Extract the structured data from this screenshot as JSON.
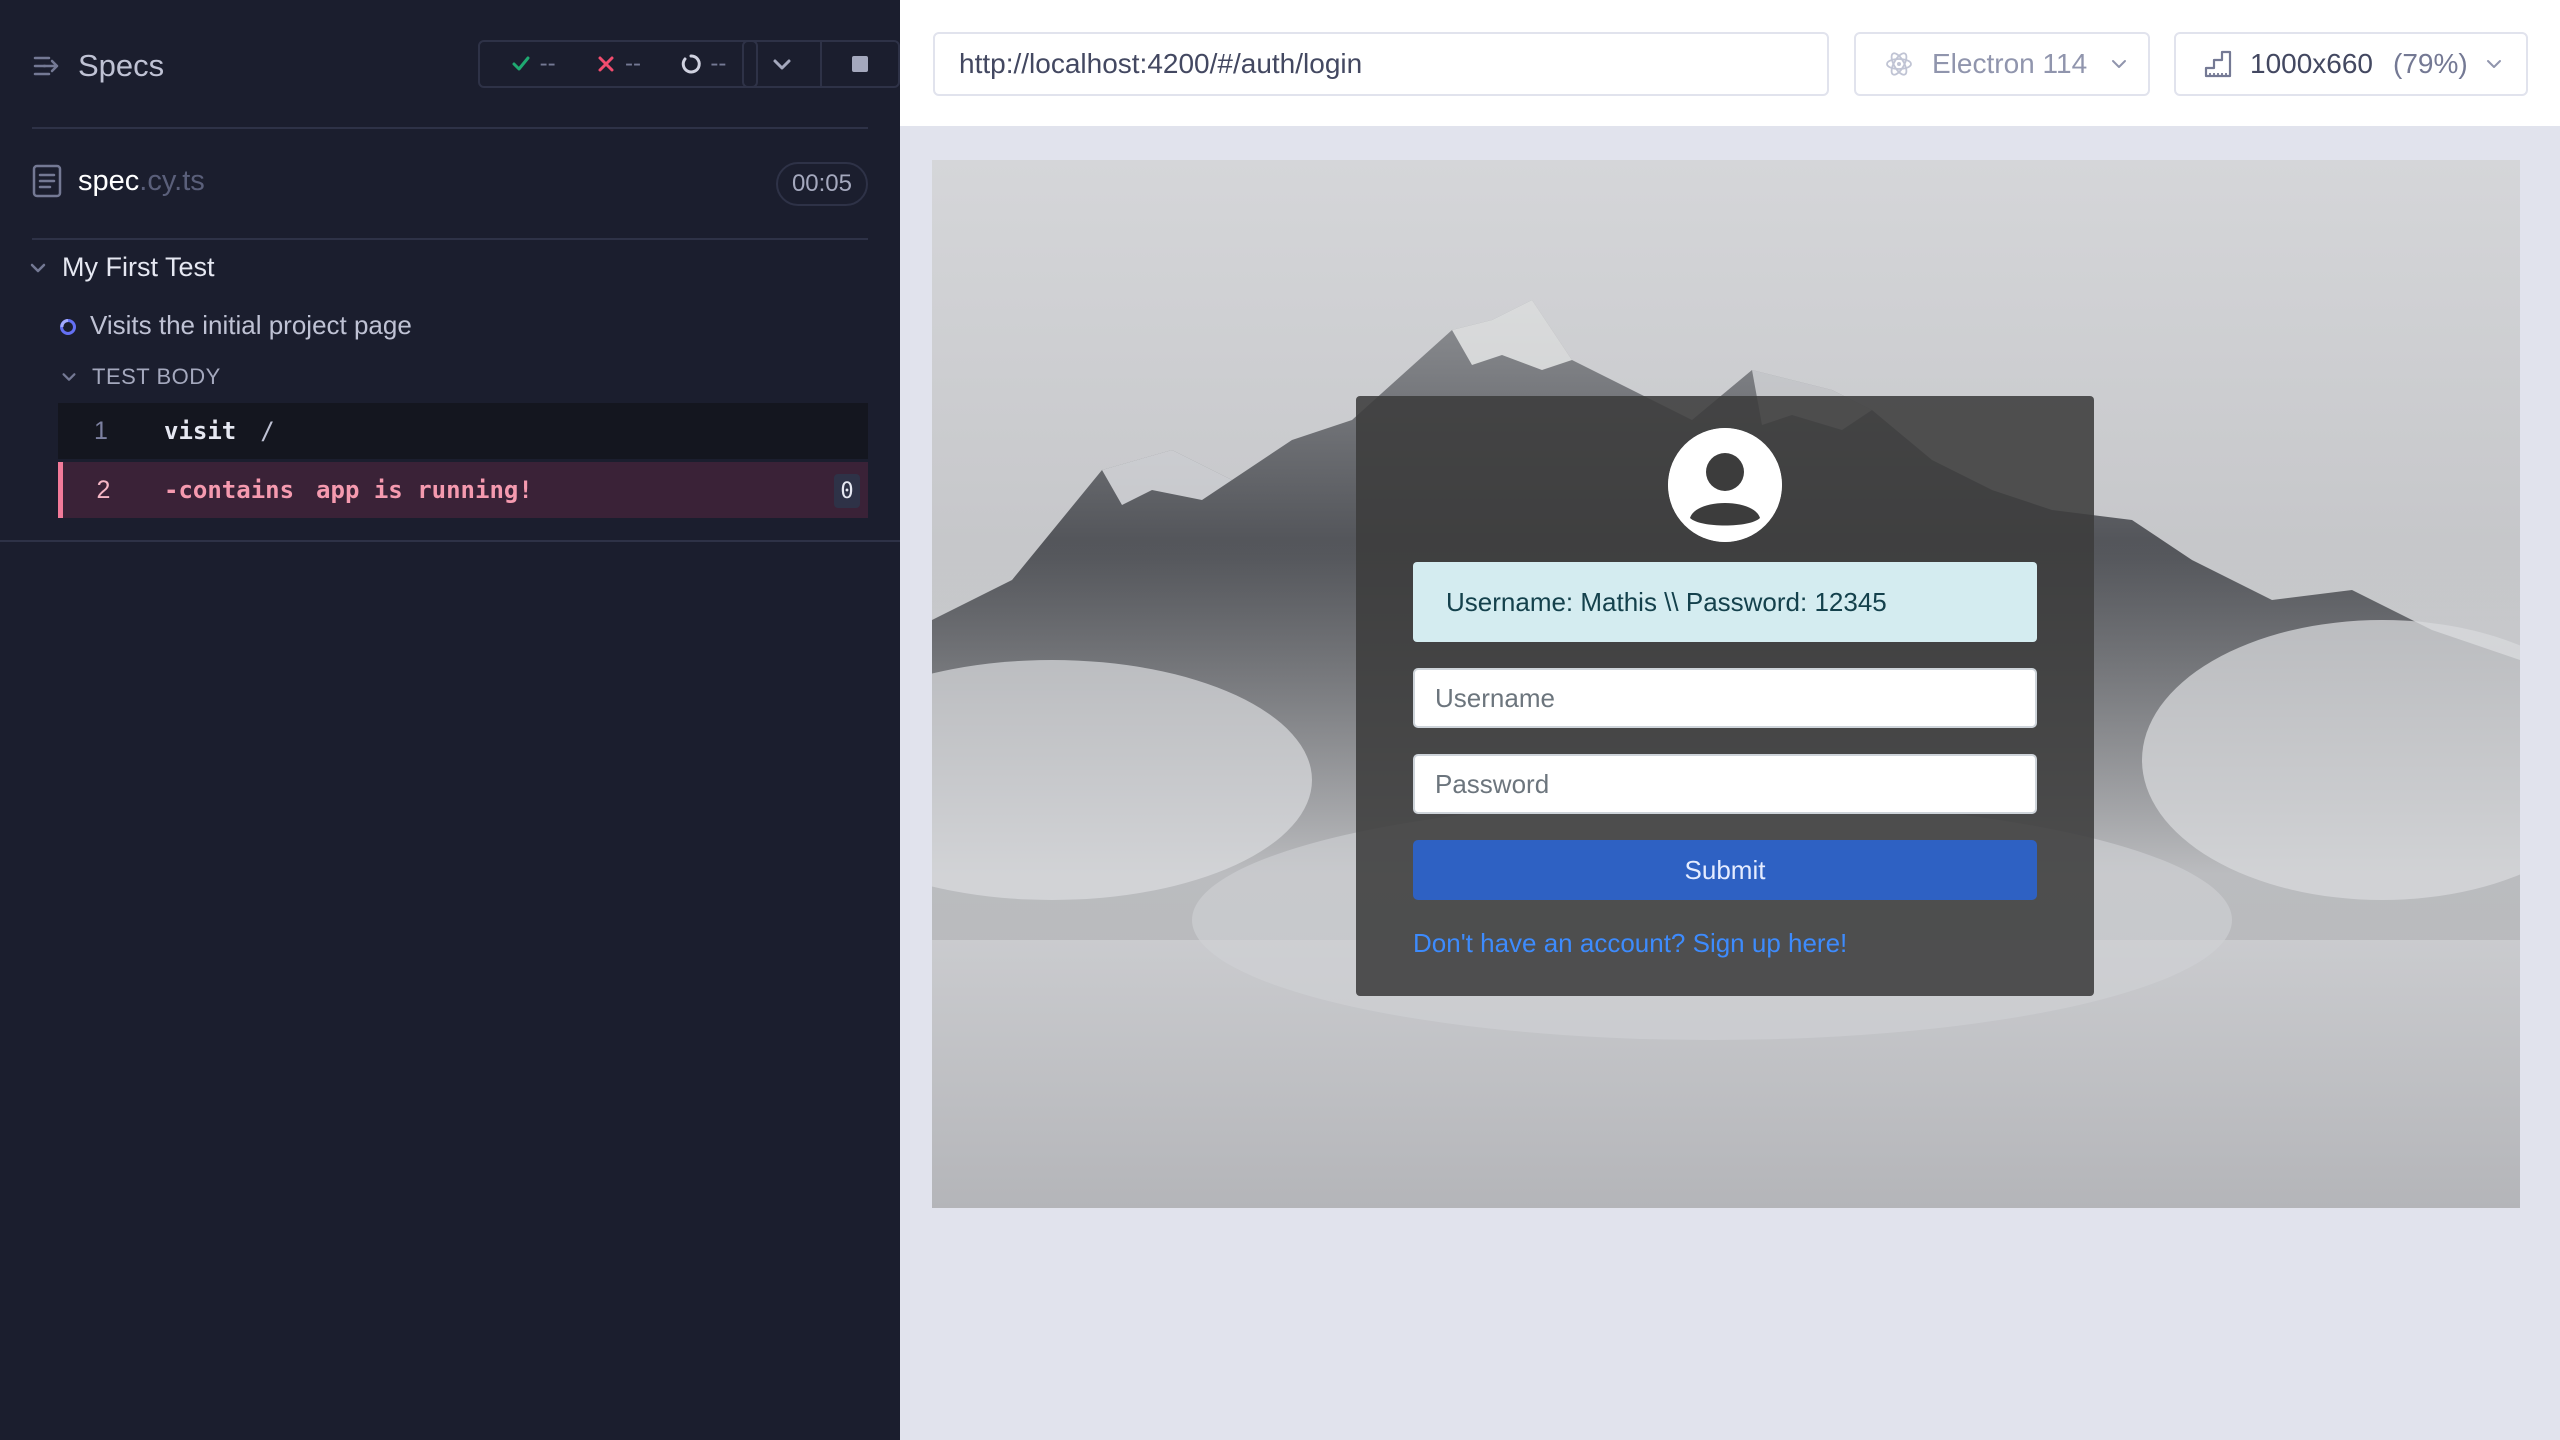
{
  "reporter": {
    "specs_label": "Specs",
    "stats": {
      "passed": "--",
      "failed": "--",
      "pending": "--"
    },
    "spec": {
      "name": "spec",
      "ext": ".cy.ts",
      "duration": "00:05"
    },
    "suite": {
      "title": "My First Test"
    },
    "test": {
      "title": "Visits the initial project page",
      "body_label": "TEST BODY"
    },
    "commands": [
      {
        "num": "1",
        "name": "visit",
        "message": "/"
      },
      {
        "num": "2",
        "name": "-contains",
        "message": "app is running!",
        "badge": "0"
      }
    ],
    "colors": {
      "background": "#1b1e2e",
      "failed": "#f27a99",
      "passed": "#1fa971",
      "pending": "#4956e3"
    }
  },
  "topbar": {
    "url": "http://localhost:4200/#/auth/login",
    "browser": "Electron 114",
    "viewport": "1000x660",
    "viewport_scale": "(79%)"
  },
  "app": {
    "alert_text": "Username: Mathis \\\\ Password: 12345",
    "username_placeholder": "Username",
    "password_placeholder": "Password",
    "submit_label": "Submit",
    "signup_link": "Don't have an account? Sign up here!",
    "colors": {
      "card": "#3c3c3c",
      "alert_bg": "#d4ecf0",
      "submit": "#2e61c3",
      "link": "#3d8bfd"
    }
  }
}
